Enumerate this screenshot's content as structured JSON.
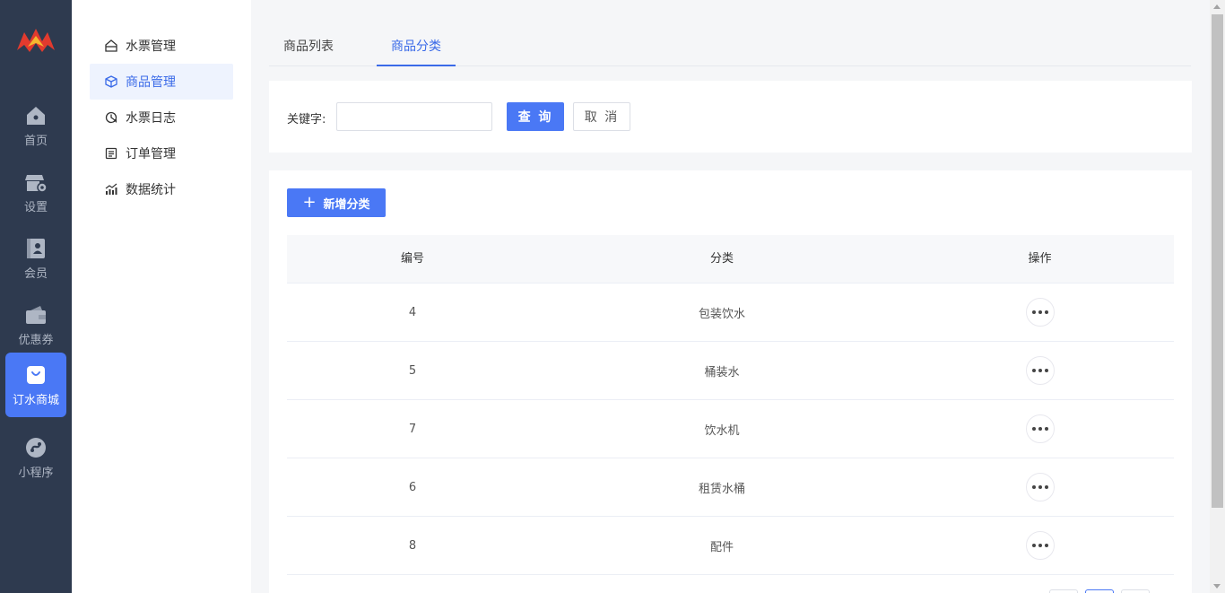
{
  "nav": {
    "items": [
      {
        "label": "首页",
        "icon": "home-icon"
      },
      {
        "label": "设置",
        "icon": "store-settings-icon"
      },
      {
        "label": "会员",
        "icon": "member-card-icon"
      },
      {
        "label": "优惠券",
        "icon": "wallet-icon"
      },
      {
        "label": "订水商城",
        "icon": "shopping-bag-icon",
        "active": true
      },
      {
        "label": "小程序",
        "icon": "mini-program-icon"
      }
    ]
  },
  "submenu": {
    "items": [
      {
        "label": "水票管理",
        "icon": "ticket-icon"
      },
      {
        "label": "商品管理",
        "icon": "cube-icon",
        "active": true
      },
      {
        "label": "水票日志",
        "icon": "clock-pie-icon"
      },
      {
        "label": "订单管理",
        "icon": "list-doc-icon"
      },
      {
        "label": "数据统计",
        "icon": "chart-icon"
      }
    ]
  },
  "tabs": [
    {
      "label": "商品列表"
    },
    {
      "label": "商品分类",
      "active": true
    }
  ],
  "filter": {
    "keyword_label": "关键字:",
    "keyword_value": "",
    "query_label": "查 询",
    "cancel_label": "取 消"
  },
  "add_button": {
    "label": "新增分类"
  },
  "table": {
    "headers": [
      "编号",
      "分类",
      "操作"
    ],
    "rows": [
      {
        "id": "4",
        "category": "包装饮水"
      },
      {
        "id": "5",
        "category": "桶装水"
      },
      {
        "id": "7",
        "category": "饮水机"
      },
      {
        "id": "6",
        "category": "租赁水桶"
      },
      {
        "id": "8",
        "category": "配件"
      }
    ]
  },
  "colors": {
    "primary": "#4a78f5",
    "nav_bg": "#2e3a4f",
    "active_text": "#3a6ae8"
  }
}
